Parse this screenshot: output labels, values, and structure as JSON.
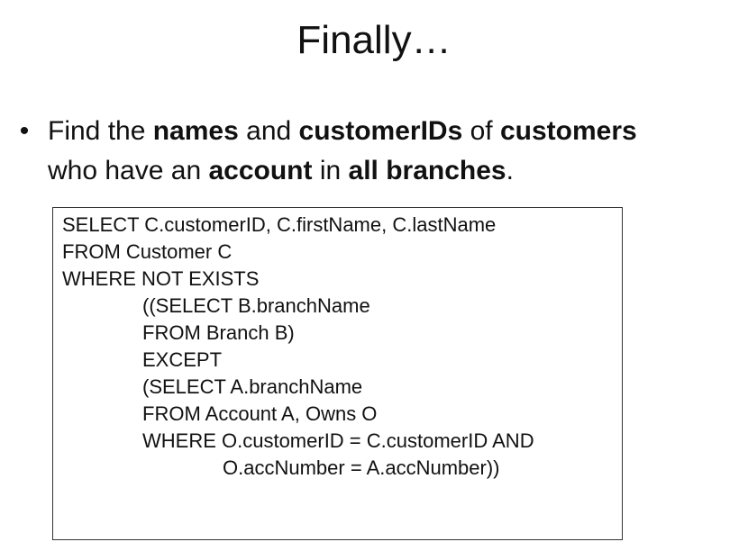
{
  "slide": {
    "title": "Finally…",
    "bullet": {
      "marker": "•",
      "parts": [
        {
          "text": "Find the ",
          "bold": false
        },
        {
          "text": "names",
          "bold": true
        },
        {
          "text": " and ",
          "bold": false
        },
        {
          "text": "customerIDs",
          "bold": true
        },
        {
          "text": " of ",
          "bold": false
        },
        {
          "text": "customers",
          "bold": true
        },
        {
          "text": "who have an ",
          "bold": false
        },
        {
          "text": "account",
          "bold": true
        },
        {
          "text": " in ",
          "bold": false
        },
        {
          "text": "all branches",
          "bold": true
        },
        {
          "text": ".",
          "bold": false
        }
      ]
    },
    "sql_lines": [
      {
        "text": "SELECT C.customerID, C.firstName, C.lastName",
        "indent": 0
      },
      {
        "text": "FROM Customer C",
        "indent": 0
      },
      {
        "text": "WHERE NOT EXISTS",
        "indent": 0
      },
      {
        "text": "((SELECT B.branchName",
        "indent": 1
      },
      {
        "text": "FROM Branch B)",
        "indent": 1
      },
      {
        "text": "EXCEPT",
        "indent": 1
      },
      {
        "text": "(SELECT A.branchName",
        "indent": 1
      },
      {
        "text": "FROM Account A, Owns O",
        "indent": 1
      },
      {
        "text": "WHERE O.customerID = C.customerID AND",
        "indent": 1
      },
      {
        "text": "O.accNumber = A.accNumber))",
        "indent": 2
      }
    ]
  }
}
